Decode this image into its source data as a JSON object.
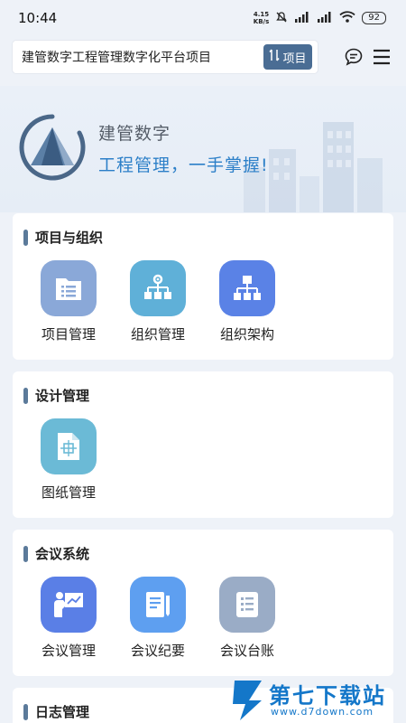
{
  "status_bar": {
    "time": "10:44",
    "net_speed_value": "4.15",
    "net_speed_unit": "KB/s",
    "battery": "92"
  },
  "header": {
    "project_name": "建管数字工程管理数字化平台项目",
    "project_button_label": "项目",
    "icons": [
      "message-icon",
      "menu-icon"
    ]
  },
  "banner": {
    "brand_name": "建管数字",
    "slogan": "工程管理，一手掌握!"
  },
  "sections": [
    {
      "title": "项目与组织",
      "items": [
        {
          "label": "项目管理",
          "icon": "folder-list-icon",
          "color": "#8aa8d8"
        },
        {
          "label": "组织管理",
          "icon": "org-gear-icon",
          "color": "#5fb0d8"
        },
        {
          "label": "组织架构",
          "icon": "org-chart-icon",
          "color": "#5a82e6"
        }
      ]
    },
    {
      "title": "设计管理",
      "items": [
        {
          "label": "图纸管理",
          "icon": "drawing-icon",
          "color": "#6bbad6"
        }
      ]
    },
    {
      "title": "会议系统",
      "items": [
        {
          "label": "会议管理",
          "icon": "presentation-icon",
          "color": "#5a7fe6"
        },
        {
          "label": "会议纪要",
          "icon": "notes-pen-icon",
          "color": "#5e9ff0"
        },
        {
          "label": "会议台账",
          "icon": "ledger-icon",
          "color": "#9aacc6"
        }
      ]
    },
    {
      "title": "日志管理",
      "items": []
    }
  ],
  "watermark": {
    "title": "第七下载站",
    "url": "www.d7down.com"
  }
}
